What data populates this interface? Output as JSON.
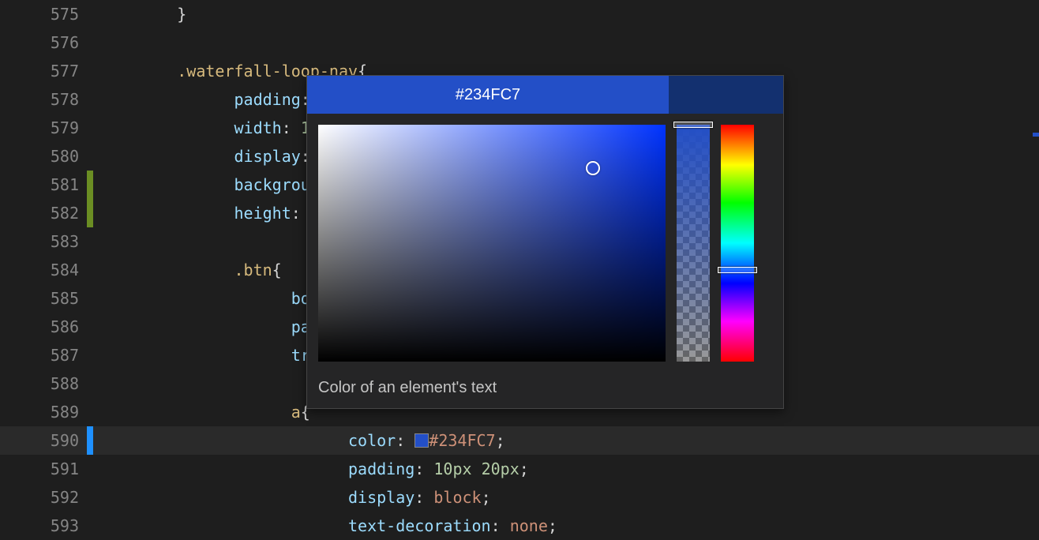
{
  "lines": [
    {
      "num": 575,
      "marker": "",
      "indent": 1,
      "tokens": [
        {
          "t": "}",
          "c": "punct"
        }
      ]
    },
    {
      "num": 576,
      "marker": "",
      "indent": 0,
      "tokens": []
    },
    {
      "num": 577,
      "marker": "",
      "indent": 1,
      "tokens": [
        {
          "t": ".waterfall-loop-nav",
          "c": "sel"
        },
        {
          "t": "{",
          "c": "punct"
        }
      ]
    },
    {
      "num": 578,
      "marker": "",
      "indent": 2,
      "tokens": [
        {
          "t": "padding",
          "c": "prop"
        },
        {
          "t": ":",
          "c": "punct"
        }
      ]
    },
    {
      "num": 579,
      "marker": "",
      "indent": 2,
      "tokens": [
        {
          "t": "width",
          "c": "prop"
        },
        {
          "t": ": ",
          "c": "punct"
        },
        {
          "t": "1",
          "c": "val"
        }
      ]
    },
    {
      "num": 580,
      "marker": "",
      "indent": 2,
      "tokens": [
        {
          "t": "display",
          "c": "prop"
        },
        {
          "t": ":",
          "c": "punct"
        }
      ]
    },
    {
      "num": 581,
      "marker": "green",
      "indent": 2,
      "tokens": [
        {
          "t": "backgrou",
          "c": "prop"
        }
      ]
    },
    {
      "num": 582,
      "marker": "green",
      "indent": 2,
      "tokens": [
        {
          "t": "height",
          "c": "prop"
        },
        {
          "t": ": ",
          "c": "punct"
        }
      ]
    },
    {
      "num": 583,
      "marker": "",
      "indent": 0,
      "tokens": []
    },
    {
      "num": 584,
      "marker": "",
      "indent": 2,
      "tokens": [
        {
          "t": ".btn",
          "c": "sel"
        },
        {
          "t": "{",
          "c": "punct"
        }
      ]
    },
    {
      "num": 585,
      "marker": "",
      "indent": 3,
      "tokens": [
        {
          "t": "bord",
          "c": "prop"
        }
      ]
    },
    {
      "num": 586,
      "marker": "",
      "indent": 3,
      "tokens": [
        {
          "t": "padd",
          "c": "prop"
        }
      ]
    },
    {
      "num": 587,
      "marker": "",
      "indent": 3,
      "tokens": [
        {
          "t": "tran",
          "c": "prop"
        }
      ]
    },
    {
      "num": 588,
      "marker": "",
      "indent": 0,
      "tokens": []
    },
    {
      "num": 589,
      "marker": "",
      "indent": 3,
      "tokens": [
        {
          "t": "a",
          "c": "sel"
        },
        {
          "t": "{",
          "c": "punct"
        }
      ]
    },
    {
      "num": 590,
      "marker": "blue",
      "indent": 4,
      "highlight": true,
      "tokens": [
        {
          "t": "color",
          "c": "prop"
        },
        {
          "t": ": ",
          "c": "punct"
        },
        {
          "swatch": "#234FC7"
        },
        {
          "t": "#234FC7",
          "c": "hex"
        },
        {
          "t": ";",
          "c": "punct"
        }
      ]
    },
    {
      "num": 591,
      "marker": "",
      "indent": 4,
      "tokens": [
        {
          "t": "padding",
          "c": "prop"
        },
        {
          "t": ": ",
          "c": "punct"
        },
        {
          "t": "10px",
          "c": "val"
        },
        {
          "t": " ",
          "c": "punct"
        },
        {
          "t": "20px",
          "c": "val"
        },
        {
          "t": ";",
          "c": "punct"
        }
      ]
    },
    {
      "num": 592,
      "marker": "",
      "indent": 4,
      "tokens": [
        {
          "t": "display",
          "c": "prop"
        },
        {
          "t": ": ",
          "c": "punct"
        },
        {
          "t": "block",
          "c": "keyw"
        },
        {
          "t": ";",
          "c": "punct"
        }
      ]
    },
    {
      "num": 593,
      "marker": "",
      "indent": 4,
      "tokens": [
        {
          "t": "text-decoration",
          "c": "prop"
        },
        {
          "t": ": ",
          "c": "punct"
        },
        {
          "t": "none",
          "c": "keyw"
        },
        {
          "t": ";",
          "c": "punct"
        }
      ]
    }
  ],
  "picker": {
    "title": "#234FC7",
    "footer": "Color of an element's text",
    "color": "#234FC7"
  }
}
